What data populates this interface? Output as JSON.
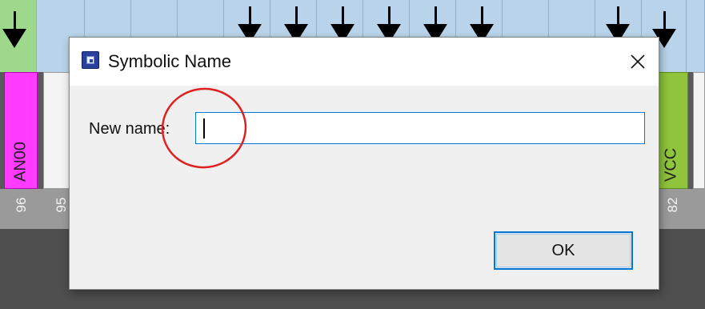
{
  "background": {
    "pin_labels": [
      "AN00",
      "VCC"
    ],
    "pin_numbers": [
      "96",
      "95",
      "82"
    ],
    "colors": {
      "pin_top": "#b9d4ea",
      "pin_top_green": "#9ed88a",
      "pin_magenta": "#ff3cff",
      "pin_lime": "#8fc43c"
    }
  },
  "dialog": {
    "title": "Symbolic Name",
    "app_icon": "chip-icon",
    "close_icon": "close-icon",
    "field_label": "New name:",
    "input_value": "",
    "ok_label": "OK",
    "accent_color": "#0078d7"
  },
  "annotation": {
    "type": "red-circle-highlight",
    "color": "#e02020"
  }
}
